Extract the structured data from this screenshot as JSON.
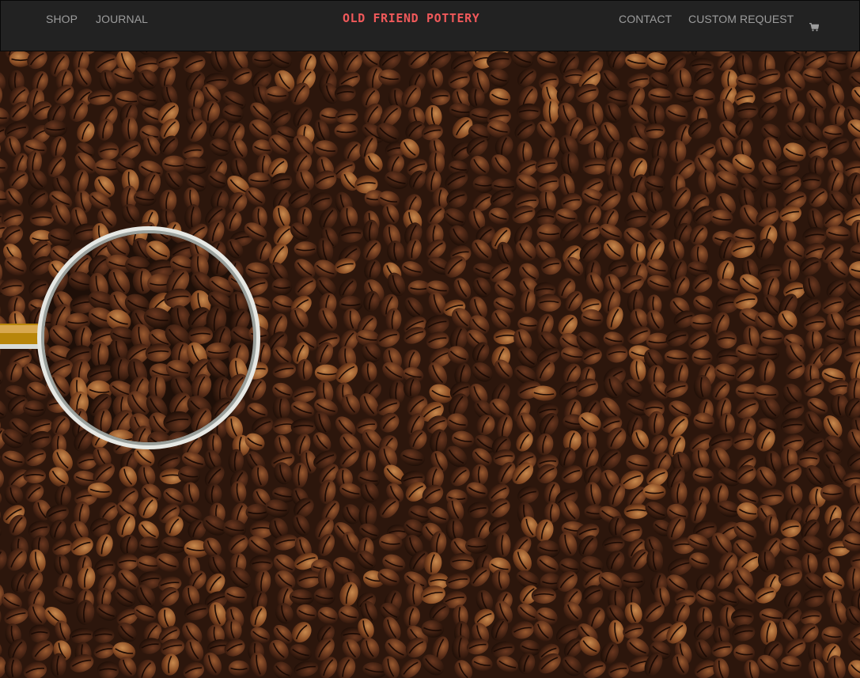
{
  "nav": {
    "left_links": [
      "SHOP",
      "JOURNAL"
    ],
    "brand": "OLD FRIEND POTTERY",
    "right_links": [
      "CONTACT",
      "CUSTOM REQUEST"
    ],
    "cart_icon": "shopping-cart-icon"
  },
  "hero": {
    "image": "coffee-beans-with-metal-scoop-photo",
    "colors": {
      "bean_dark": "#3b1f12",
      "bean_mid": "#6b3a22",
      "bean_light": "#a0602f",
      "scoop_rim": "#d8dcd8"
    }
  }
}
